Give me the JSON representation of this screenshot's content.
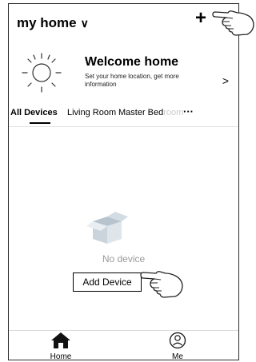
{
  "header": {
    "home_name": "my home",
    "home_chevron": "∨",
    "add_label": "+"
  },
  "welcome": {
    "title": "Welcome home",
    "description": "Set your home location, get more information",
    "arrow": ">",
    "icon": "sun-icon"
  },
  "tabs": {
    "items": [
      {
        "label": "All Devices"
      },
      {
        "label": "Living Room"
      },
      {
        "label": "Master Bed"
      },
      {
        "label": "room"
      }
    ],
    "more": "···"
  },
  "empty_state": {
    "message": "No device",
    "button_label": "Add Device",
    "icon": "empty-box-icon"
  },
  "bottom_nav": {
    "items": [
      {
        "label": "Home",
        "icon": "home-icon"
      },
      {
        "label": "Me",
        "icon": "user-icon"
      }
    ]
  },
  "annotations": {
    "pointer_icon": "pointing-hand-icon"
  }
}
